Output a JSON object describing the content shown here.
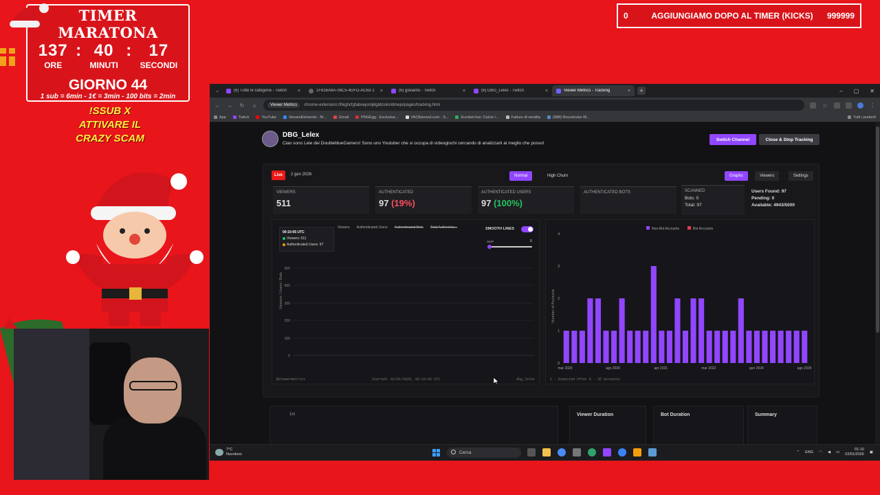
{
  "overlay": {
    "timer": {
      "title": "TIMER MARATONA",
      "hours": "137",
      "minutes": "40",
      "seconds": "17",
      "hours_label": "ORE",
      "minutes_label": "MINUTI",
      "seconds_label": "SECONDI",
      "separator": ":",
      "day": "GIORNO 44",
      "rules": "1 sub = 6min - 1€ = 3min - 100 bits = 2min"
    },
    "promo_line1": "!SSUB X",
    "promo_line2": "ATTIVARE IL",
    "promo_line3": "CRAZY SCAM",
    "kicks": {
      "left_value": "0",
      "label": "AGGIUNGIAMO DOPO AL TIMER (KICKS)",
      "right_value": "999999"
    }
  },
  "browser": {
    "tabs": [
      {
        "title": "(6) Tutte le categorie - Twitch",
        "icon": "twitch-icon"
      },
      {
        "title": "1F816A8A-06C5-4DFD-AC63-1",
        "icon": "page-icon"
      },
      {
        "title": "(6) gskianto - Twitch",
        "icon": "twitch-icon"
      },
      {
        "title": "(6) DBG_Lelex - Twitch",
        "icon": "twitch-icon"
      },
      {
        "title": "Viewer Metrics - Tracking",
        "icon": "extension-icon"
      }
    ],
    "tab_close": "×",
    "new_tab": "+",
    "address_chip": "Viewer Metrics",
    "url": "chrome-extension://hkghcfgfaboejomjklgldciolondmejo/pages/tracking.html",
    "bookmarks": [
      "App",
      "Twitch",
      "YouTube",
      "StreamElements - M...",
      "Gmail",
      "PNGEgg - Exclusive...",
      "VACBanned.com - S...",
      "Eurobet.live: Calcio /...",
      "Fatture di vendita",
      "(888) Roundcube W..."
    ],
    "bookmarks_right": "Tutti i preferiti"
  },
  "page": {
    "channel": {
      "name": "DBG_Lelex",
      "description": "Ciao sono Lele dei DoubleblueGamers! Sono uno Youtuber che si occupa di videogiochi cercando di analizzarli al meglio che posso!"
    },
    "switch_channel": "Switch Channel",
    "close_stop": "Close & Stop Tracking",
    "live_badge": "Live",
    "live_date": "2 gen 2026",
    "mode_normal": "Normal",
    "mode_high_churn": "High Churn",
    "view_graphs": "Graphs",
    "view_viewers": "Viewers",
    "view_settings": "Settings",
    "stats": {
      "viewers_label": "VIEWERS",
      "viewers_value": "511",
      "authenticated_label": "AUTHENTICATED",
      "authenticated_value": "97",
      "authenticated_pct": "(19%)",
      "auth_users_label": "AUTHENTICATED USERS",
      "auth_users_value": "97",
      "auth_users_pct": "(100%)",
      "auth_bots_label": "AUTHENTICATED BOTS",
      "scanned_label": "SCANNED",
      "scanned_bots": "Bots: 0",
      "scanned_total": "Total: 97",
      "users_found": "Users Found: 97",
      "pending": "Pending: 0",
      "available": "Available: 4943/5000"
    },
    "line_chart": {
      "legend": [
        "Viewers",
        "Authenticated Users",
        "Authenticated Bots",
        "Total Authentica..."
      ],
      "smooth_lines": "SMOOTH LINES",
      "skip_label": "SKIP",
      "skip_value": "0",
      "tooltip_time": "00:10:05 UTC",
      "tooltip_viewers": "Viewers: 511",
      "tooltip_auth": "Authenticated Users: 97",
      "ylabel": "Viewers / Users / Bots",
      "yticks": [
        "500",
        "400",
        "300",
        "200",
        "100",
        "0"
      ],
      "footer_left": "@viewermetrics",
      "footer_center": "Started: 02/01/2026, 00:10:05 UTC",
      "footer_right": "dbg_lelex"
    },
    "bar_chart_footer": "2 · Expected After 6 · 35 accounts",
    "lower": {
      "label_1m": "1m",
      "viewer_duration": "Viewer Duration",
      "bot_duration": "Bot Duration",
      "summary": "Summary"
    }
  },
  "chart_data": {
    "type": "bar",
    "legend": [
      "Non-Bot Accounts",
      "Bot Accounts"
    ],
    "ylabel": "Number of Accounts",
    "ylim": [
      0,
      4
    ],
    "yticks": [
      "4",
      "3",
      "2",
      "1",
      "0"
    ],
    "xticks": [
      "mar 2020",
      "ago 2020",
      "apr 2021",
      "mar 2022",
      "gen 2024",
      "ago 2025"
    ],
    "series": [
      {
        "name": "Non-Bot Accounts",
        "color": "#9146ff",
        "values": [
          1,
          1,
          1,
          2,
          2,
          1,
          1,
          2,
          1,
          1,
          1,
          3,
          1,
          1,
          2,
          1,
          2,
          2,
          1,
          1,
          1,
          1,
          2,
          1,
          1,
          1,
          1,
          1,
          1,
          1,
          1
        ]
      },
      {
        "name": "Bot Accounts",
        "color": "#e53950",
        "values": [
          0,
          0,
          0,
          0,
          0,
          0,
          0,
          0,
          0,
          0,
          0,
          0,
          0,
          0,
          0,
          0,
          0,
          0,
          0,
          0,
          0,
          0,
          0,
          0,
          0,
          0,
          0,
          0,
          0,
          0,
          0
        ]
      }
    ]
  },
  "taskbar": {
    "temperature": "7°C",
    "weather": "Nuvoloso",
    "search": "Cerca",
    "lang": "ENG",
    "time": "01:10",
    "date": "02/01/2026"
  }
}
